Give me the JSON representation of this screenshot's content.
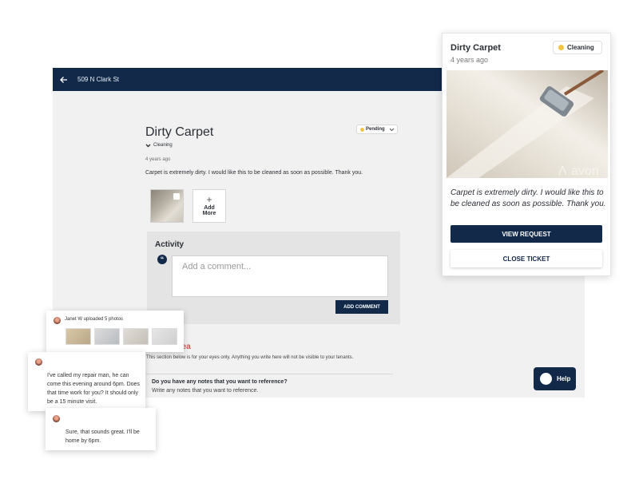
{
  "topbar": {
    "address": "509 N Clark St"
  },
  "ticket": {
    "title": "Dirty Carpet",
    "status": "Pending",
    "category": "Cleaning",
    "time": "4 years ago",
    "description": "Carpet is extremely dirty. I would like this to be cleaned as soon as possible. Thank you.",
    "add_more_label": "Add More",
    "add_more_plus": "+"
  },
  "activity": {
    "title": "Activity",
    "comment_placeholder": "Add a comment...",
    "add_comment_label": "ADD COMMENT",
    "quote_glyph": "“"
  },
  "read_only": {
    "title": "d Only Area",
    "description": "This section below is for your eyes only. Anything you write here will not be visible to your tenants.",
    "notes_question": "Do you have any notes that you want to reference?",
    "notes_placeholder": "Write any notes that you want to reference."
  },
  "help": {
    "label": "Help"
  },
  "card": {
    "title": "Dirty Carpet",
    "time": "4 years ago",
    "badge": "Cleaning",
    "description": "Carpet is extremely dirty. I would like this to be cleaned as soon as possible. Thank you.",
    "view_label": "VIEW REQUEST",
    "close_label": "CLOSE TICKET"
  },
  "feed": {
    "upload_text": "Janet W uploaded 5 photos",
    "message1": "I've called my repair man, he can come this evening around 6pm. Does that time work for you? It should only be a 15 minute visit.",
    "message2": "Sure, that sounds great. I'll be home by 6pm."
  },
  "colors": {
    "primary": "#12294a",
    "accent_red": "#d9534f",
    "status_dot": "#f4c542"
  },
  "icons": [
    "back-arrow-icon",
    "chevron-down-icon",
    "quote-icon",
    "image-icon",
    "chat-bubble-icon"
  ]
}
